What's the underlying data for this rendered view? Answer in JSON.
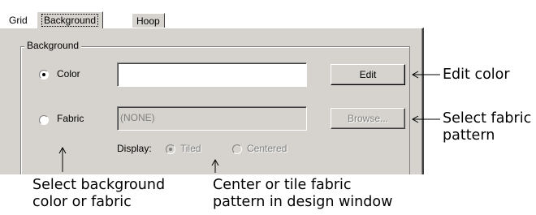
{
  "tabs": [
    {
      "label": "Grid"
    },
    {
      "label": "Background"
    },
    {
      "label": "Hoop"
    }
  ],
  "group": {
    "label": "Background"
  },
  "color_row": {
    "radio_label": "Color",
    "selected": true,
    "field_value": "",
    "button_label": "Edit"
  },
  "fabric_row": {
    "radio_label": "Fabric",
    "selected": false,
    "field_value": "(NONE)",
    "button_label": "Browse..."
  },
  "display_row": {
    "label": "Display:",
    "options": [
      {
        "label": "Tiled",
        "selected": true
      },
      {
        "label": "Centered",
        "selected": false
      }
    ]
  },
  "callouts": {
    "edit_color": "Edit color",
    "select_fabric_pattern": [
      "Select fabric",
      "pattern"
    ],
    "select_background": [
      "Select background",
      "color or fabric"
    ],
    "center_or_tile": [
      "Center or tile fabric",
      "pattern in design window"
    ]
  }
}
